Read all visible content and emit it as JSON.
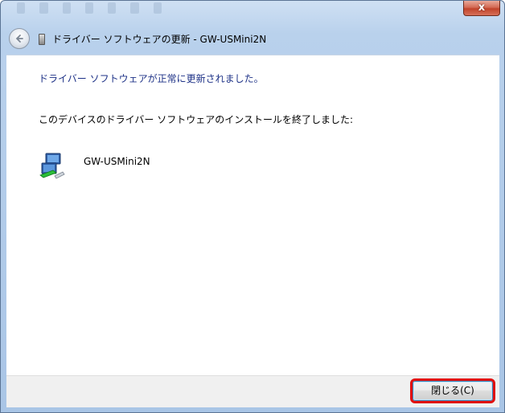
{
  "window": {
    "nav_title": "ドライバー ソフトウェアの更新 - GW-USMini2N",
    "close_glyph": "x"
  },
  "content": {
    "heading": "ドライバー ソフトウェアが正常に更新されました。",
    "message": "このデバイスのドライバー ソフトウェアのインストールを終了しました:",
    "device_name": "GW-USMini2N"
  },
  "footer": {
    "close_button_label": "閉じる(C)"
  },
  "colors": {
    "heading": "#1e3287",
    "highlight_outline": "#e01010",
    "close_titlebar": "#c1432a"
  },
  "icons": {
    "back": "back-arrow-icon",
    "device_small": "usb-device-icon",
    "device": "network-adapter-icon"
  }
}
